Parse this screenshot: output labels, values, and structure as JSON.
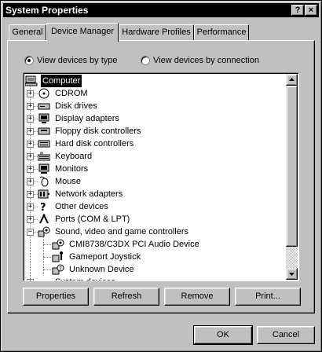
{
  "window": {
    "title": "System Properties",
    "help_button": "?",
    "close_button": "×"
  },
  "tabs": [
    {
      "label": "General"
    },
    {
      "label": "Device Manager",
      "active": true
    },
    {
      "label": "Hardware Profiles"
    },
    {
      "label": "Performance"
    }
  ],
  "view_options": {
    "by_type_label": "View devices by type",
    "by_connection_label": "View devices by connection",
    "selected": "by_type"
  },
  "device_tree": {
    "root": "Computer",
    "items": [
      {
        "label": "CDROM",
        "icon": "cdrom-icon",
        "expand": "+"
      },
      {
        "label": "Disk drives",
        "icon": "disk-drive-icon",
        "expand": "+"
      },
      {
        "label": "Display adapters",
        "icon": "display-adapter-icon",
        "expand": "+"
      },
      {
        "label": "Floppy disk controllers",
        "icon": "floppy-controller-icon",
        "expand": "+"
      },
      {
        "label": "Hard disk controllers",
        "icon": "hard-disk-controller-icon",
        "expand": "+"
      },
      {
        "label": "Keyboard",
        "icon": "keyboard-icon",
        "expand": "+"
      },
      {
        "label": "Monitors",
        "icon": "monitor-icon",
        "expand": "+"
      },
      {
        "label": "Mouse",
        "icon": "mouse-icon",
        "expand": "+"
      },
      {
        "label": "Network adapters",
        "icon": "network-adapter-icon",
        "expand": "+"
      },
      {
        "label": "Other devices",
        "icon": "question-mark-icon",
        "expand": "+"
      },
      {
        "label": "Ports (COM & LPT)",
        "icon": "port-icon",
        "expand": "+"
      },
      {
        "label": "Sound, video and game controllers",
        "icon": "sound-icon",
        "expand": "−"
      }
    ],
    "children": [
      {
        "label": "CMI8738/C3DX PCI Audio Device",
        "icon": "audio-device-icon"
      },
      {
        "label": "Gameport Joystick",
        "icon": "joystick-icon"
      },
      {
        "label": "Unknown Device",
        "icon": "unknown-device-icon"
      }
    ],
    "partial_last": "System devices"
  },
  "buttons": {
    "properties": "Properties",
    "refresh": "Refresh",
    "remove": "Remove",
    "print": "Print...",
    "ok": "OK",
    "cancel": "Cancel"
  }
}
